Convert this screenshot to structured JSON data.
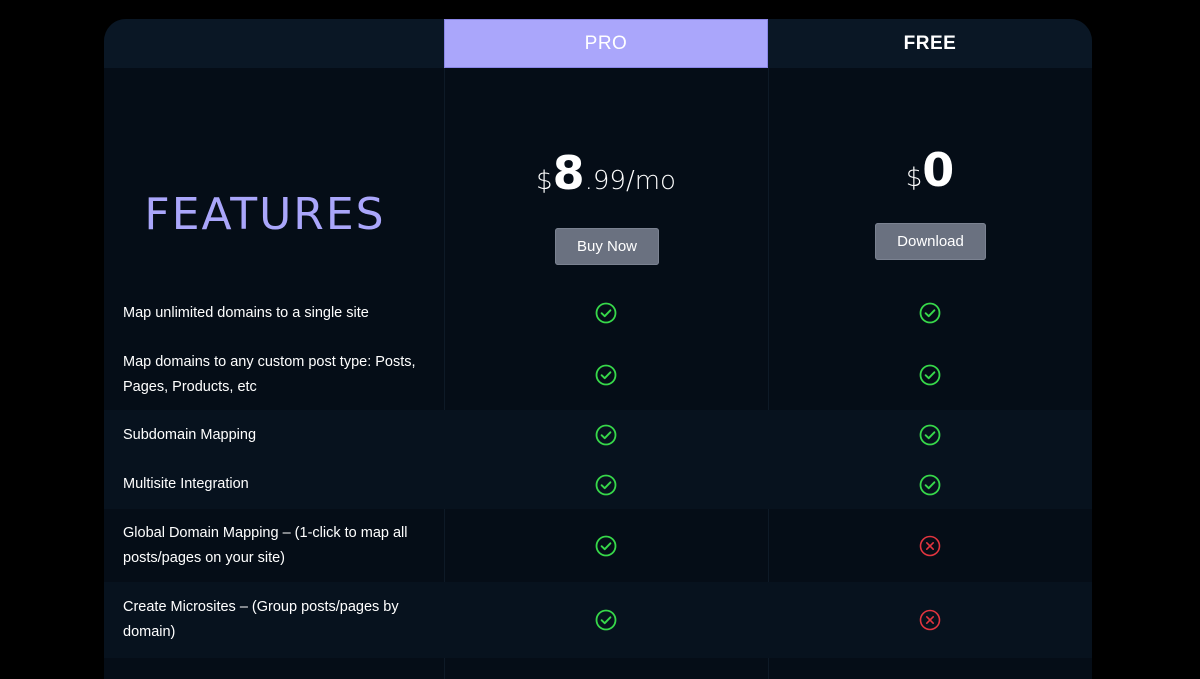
{
  "header": {
    "pro_label": "PRO",
    "free_label": "FREE"
  },
  "features_title": "FEATURES",
  "plans": {
    "pro": {
      "currency": "$",
      "price_main": "8",
      "price_rest": ".99/mo",
      "button_label": "Buy Now"
    },
    "free": {
      "currency": "$",
      "price_main": "0",
      "button_label": "Download"
    }
  },
  "colors": {
    "accent": "#aaa6fb",
    "check": "#37d84a",
    "cross": "#e2353f"
  },
  "rows": [
    {
      "label": "Map unlimited domains to a single site",
      "pro": "check-icon",
      "free": "check-icon"
    },
    {
      "label": "Map domains to any custom post type: Posts, Pages, Products, etc",
      "pro": "check-icon",
      "free": "check-icon"
    },
    {
      "label": "Subdomain Mapping",
      "pro": "check-icon",
      "free": "check-icon"
    },
    {
      "label": "Multisite Integration",
      "pro": "check-icon",
      "free": "check-icon"
    },
    {
      "label": "Global Domain Mapping – (1-click to map all posts/pages on your site)",
      "pro": "check-icon",
      "free": "cross-icon"
    },
    {
      "label": "Create Microsites – (Group posts/pages by domain)",
      "pro": "check-icon",
      "free": "cross-icon"
    }
  ]
}
